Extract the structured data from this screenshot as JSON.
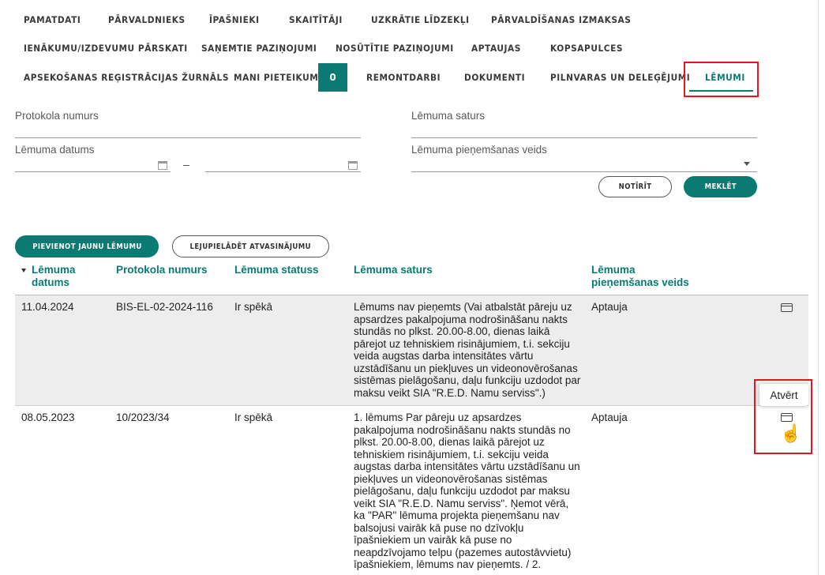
{
  "nav": {
    "row1": [
      "Pamatdati",
      "Pārvaldnieks",
      "Īpašnieki",
      "Skaitītāji",
      "Uzkrātie līdzekļi",
      "Pārvaldīšanas izmaksas"
    ],
    "row2": [
      "Ienākumu/izdevumu pārskati",
      "Saņemtie paziņojumi",
      "Nosūtītie paziņojumi",
      "Aptaujas",
      "Kopsapulces"
    ],
    "row3": [
      "Apsekošanas reģistrācijas žurnāls",
      "Mani pieteikumi",
      "Remontdarbi",
      "Dokumenti",
      "Pilnvaras un deleģējumi",
      "Lēmumi"
    ],
    "mani_pieteikumi_count": "0",
    "active": "Lēmumi"
  },
  "filters": {
    "protokola_numurs_label": "Protokola numurs",
    "protokola_numurs_value": "",
    "lemuma_saturs_label": "Lēmuma saturs",
    "lemuma_saturs_value": "",
    "lemuma_datums_label": "Lēmuma datums",
    "date_from": "",
    "date_to": "",
    "date_separator": "–",
    "pienemsanas_veids_label": "Lēmuma pieņemšanas veids",
    "pienemsanas_veids_value": "",
    "clear_button": "Notīrīt",
    "search_button": "Meklēt"
  },
  "actions": {
    "add_button": "Pievienot jaunu lēmumu",
    "download_button": "Lejupielādēt atvasinājumu"
  },
  "table": {
    "headers": {
      "datums": "Lēmuma datums",
      "protokols": "Protokola numurs",
      "statuss": "Lēmuma statuss",
      "saturs": "Lēmuma saturs",
      "veids": "Lēmuma pieņemšanas veids"
    },
    "rows": [
      {
        "datums": "11.04.2024",
        "protokols": "BIS-EL-02-2024-116",
        "statuss": "Ir spēkā",
        "saturs": "Lēmums nav pieņemts (Vai atbalstāt pāreju uz apsardzes pakalpojuma nodrošināšanu nakts stundās no plkst. 20.00-8.00, dienas laikā pārejot uz tehniskiem risinājumiem, t.i. sekciju veida augstas darba intensitātes vārtu uzstādīšanu un piekļuves un videonovērošanas sistēmas pielāgošanu, daļu funkciju uzdodot par maksu veikt SIA \"R.E.D. Namu serviss\".)",
        "veids": "Aptauja"
      },
      {
        "datums": "08.05.2023",
        "protokols": "10/2023/34",
        "statuss": "Ir spēkā",
        "saturs": "1. lēmums Par pāreju uz apsardzes pakalpojuma nodrošināšanu nakts stundās no plkst. 20.00-8.00, dienas laikā pārejot uz tehniskiem risinājumiem, t.i. sekciju veida augstas darba intensitātes vārtu uzstādīšanu un piekļuves un videonovērošanas sistēmas pielāgošanu, daļu funkciju uzdodot par maksu veikt SIA \"R.E.D. Namu serviss\". Ņemot vērā, ka \"PAR\" lēmuma projekta pieņemšanu nav balsojusi vairāk kā puse no dzīvokļu īpašniekiem un vairāk kā puse no neapdzīvojamo telpu (pazemes autostāvvietu) īpašniekiem, lēmums nav pieņemts. / 2.",
        "veids": "Aptauja"
      }
    ],
    "open_tooltip": "Atvērt"
  }
}
